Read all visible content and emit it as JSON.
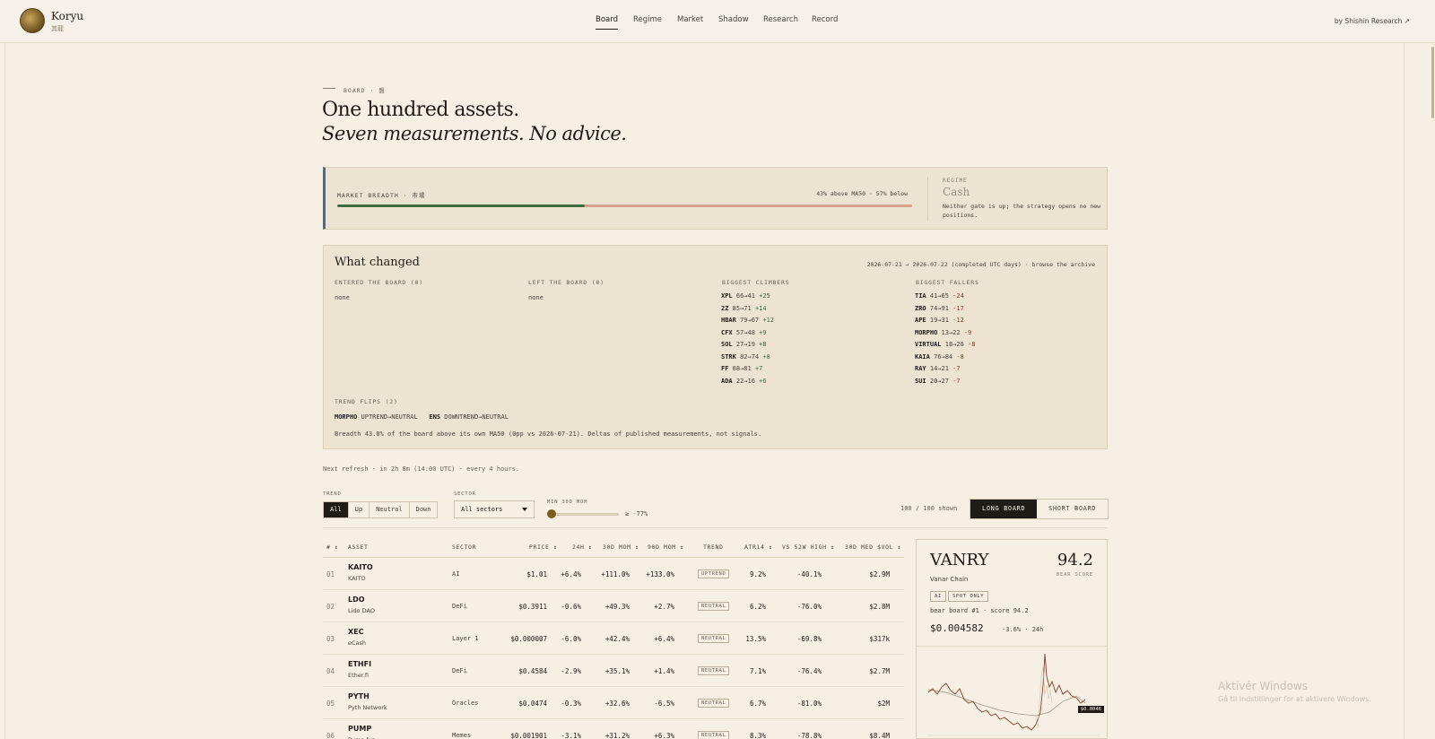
{
  "header": {
    "brand": "Koryu",
    "brand_sub": "其龍",
    "nav": [
      "Board",
      "Regime",
      "Market",
      "Shadow",
      "Research",
      "Record"
    ],
    "active_nav": "Board",
    "byline": "by Shishin Research ↗"
  },
  "hero": {
    "eyebrow": "BOARD · 盤",
    "title": "One hundred assets.",
    "subtitle": "Seven measurements. No advice."
  },
  "breadth": {
    "label": "MARKET BREADTH · 市場",
    "stat": "43% above MA50 · 57% below",
    "above_fraction": 0.43,
    "regime_label": "REGIME",
    "regime_value": "Cash",
    "regime_note": "Neither gate is up; the strategy opens no new positions."
  },
  "changed": {
    "title": "What changed",
    "range": "2026-07-21 → 2026-07-22 (completed UTC days) · browse the archive",
    "entered_label": "ENTERED THE BOARD (0)",
    "entered_value": "none",
    "left_label": "LEFT THE BOARD (0)",
    "left_value": "none",
    "climbers_label": "BIGGEST CLIMBERS",
    "climbers": [
      {
        "sym": "XPL",
        "move": "66→41",
        "delta": "+25"
      },
      {
        "sym": "2Z",
        "move": "85→71",
        "delta": "+14"
      },
      {
        "sym": "HBAR",
        "move": "79→67",
        "delta": "+12"
      },
      {
        "sym": "CFX",
        "move": "57→48",
        "delta": "+9"
      },
      {
        "sym": "SOL",
        "move": "27→19",
        "delta": "+8"
      },
      {
        "sym": "STRK",
        "move": "82→74",
        "delta": "+8"
      },
      {
        "sym": "FF",
        "move": "88→81",
        "delta": "+7"
      },
      {
        "sym": "ADA",
        "move": "22→16",
        "delta": "+6"
      }
    ],
    "fallers_label": "BIGGEST FALLERS",
    "fallers": [
      {
        "sym": "TIA",
        "move": "41→65",
        "delta": "-24"
      },
      {
        "sym": "ZRO",
        "move": "74→91",
        "delta": "-17"
      },
      {
        "sym": "APE",
        "move": "19→31",
        "delta": "-12"
      },
      {
        "sym": "MORPHO",
        "move": "13→22",
        "delta": "-9"
      },
      {
        "sym": "VIRTUAL",
        "move": "18→26",
        "delta": "-8"
      },
      {
        "sym": "KAIA",
        "move": "76→84",
        "delta": "-8"
      },
      {
        "sym": "RAY",
        "move": "14→21",
        "delta": "-7"
      },
      {
        "sym": "SUI",
        "move": "20→27",
        "delta": "-7"
      }
    ],
    "flips_label": "TREND FLIPS (2)",
    "flips": [
      {
        "sym": "MORPHO",
        "change": "UPTREND→NEUTRAL"
      },
      {
        "sym": "ENS",
        "change": "DOWNTREND→NEUTRAL"
      }
    ],
    "note": "Breadth 43.0% of the board above its own MA50 (0pp vs 2026-07-21). Deltas of published measurements, not signals."
  },
  "refresh": "Next refresh · in 2h 8m (14:00 UTC) · every 4 hours.",
  "filters": {
    "trend_label": "TREND",
    "trend_options": [
      "All",
      "Up",
      "Neutral",
      "Down"
    ],
    "trend_active": "All",
    "sector_label": "SECTOR",
    "sector_value": "All sectors",
    "mom_label": "MIN 30D MOM",
    "mom_value": "≥ -77%",
    "shown": "100 / 100 shown",
    "long_board": "LONG BOARD",
    "short_board": "SHORT BOARD"
  },
  "table": {
    "headers": [
      "#",
      "ASSET",
      "SECTOR",
      "PRICE",
      "24H",
      "30D MOM",
      "90D MOM",
      "TREND",
      "ATR14",
      "VS 52W HIGH",
      "30D MED $VOL"
    ],
    "rows": [
      {
        "rank": "01",
        "sym": "KAITO",
        "name": "KAITO",
        "sector": "AI",
        "price": "$1.01",
        "h24": "+6.4%",
        "mom30": "+111.0%",
        "mom90": "+133.0%",
        "trend": "UPTREND",
        "atr": "9.2%",
        "high52": "-40.1%",
        "vol": "$2.9M"
      },
      {
        "rank": "02",
        "sym": "LDO",
        "name": "Lido DAO",
        "sector": "DeFi",
        "price": "$0.3911",
        "h24": "-0.6%",
        "mom30": "+49.3%",
        "mom90": "+2.7%",
        "trend": "NEUTRAL",
        "atr": "6.2%",
        "high52": "-76.0%",
        "vol": "$2.8M"
      },
      {
        "rank": "03",
        "sym": "XEC",
        "name": "eCash",
        "sector": "Layer 1",
        "price": "$0.000007",
        "h24": "-6.0%",
        "mom30": "+42.4%",
        "mom90": "+6.4%",
        "trend": "NEUTRAL",
        "atr": "13.5%",
        "high52": "-69.8%",
        "vol": "$317k"
      },
      {
        "rank": "04",
        "sym": "ETHFI",
        "name": "Ether.fi",
        "sector": "DeFi",
        "price": "$0.4584",
        "h24": "-2.9%",
        "mom30": "+35.1%",
        "mom90": "+1.4%",
        "trend": "NEUTRAL",
        "atr": "7.1%",
        "high52": "-76.4%",
        "vol": "$2.7M"
      },
      {
        "rank": "05",
        "sym": "PYTH",
        "name": "Pyth Network",
        "sector": "Oracles",
        "price": "$0.0474",
        "h24": "-0.3%",
        "mom30": "+32.6%",
        "mom90": "-6.5%",
        "trend": "NEUTRAL",
        "atr": "6.7%",
        "high52": "-81.0%",
        "vol": "$2M"
      },
      {
        "rank": "06",
        "sym": "PUMP",
        "name": "Pump.fun",
        "sector": "Memes",
        "price": "$0.001901",
        "h24": "-3.1%",
        "mom30": "+31.2%",
        "mom90": "+6.3%",
        "trend": "NEUTRAL",
        "atr": "8.3%",
        "high52": "-78.8%",
        "vol": "$8.4M"
      }
    ]
  },
  "card": {
    "sym": "VANRY",
    "score": "94.2",
    "score_label": "BEAR SCORE",
    "name": "Vanar Chain",
    "tags": [
      "AI",
      "SPOT ONLY"
    ],
    "meta": "bear board #1 · score 94.2",
    "price": "$0.004582",
    "change": "-3.6% · 24h",
    "chart_tag": "$0.0046"
  },
  "watermark": {
    "line1": "Aktivér Windows",
    "line2": "Gå til Indstillinger for at aktivere Windows."
  },
  "colors": {
    "background": "#f5efe4",
    "panel": "#ece3d1",
    "breadth_up": "#3f6b43",
    "breadth_down": "#d4a08e",
    "ink": "#1f1c18"
  }
}
